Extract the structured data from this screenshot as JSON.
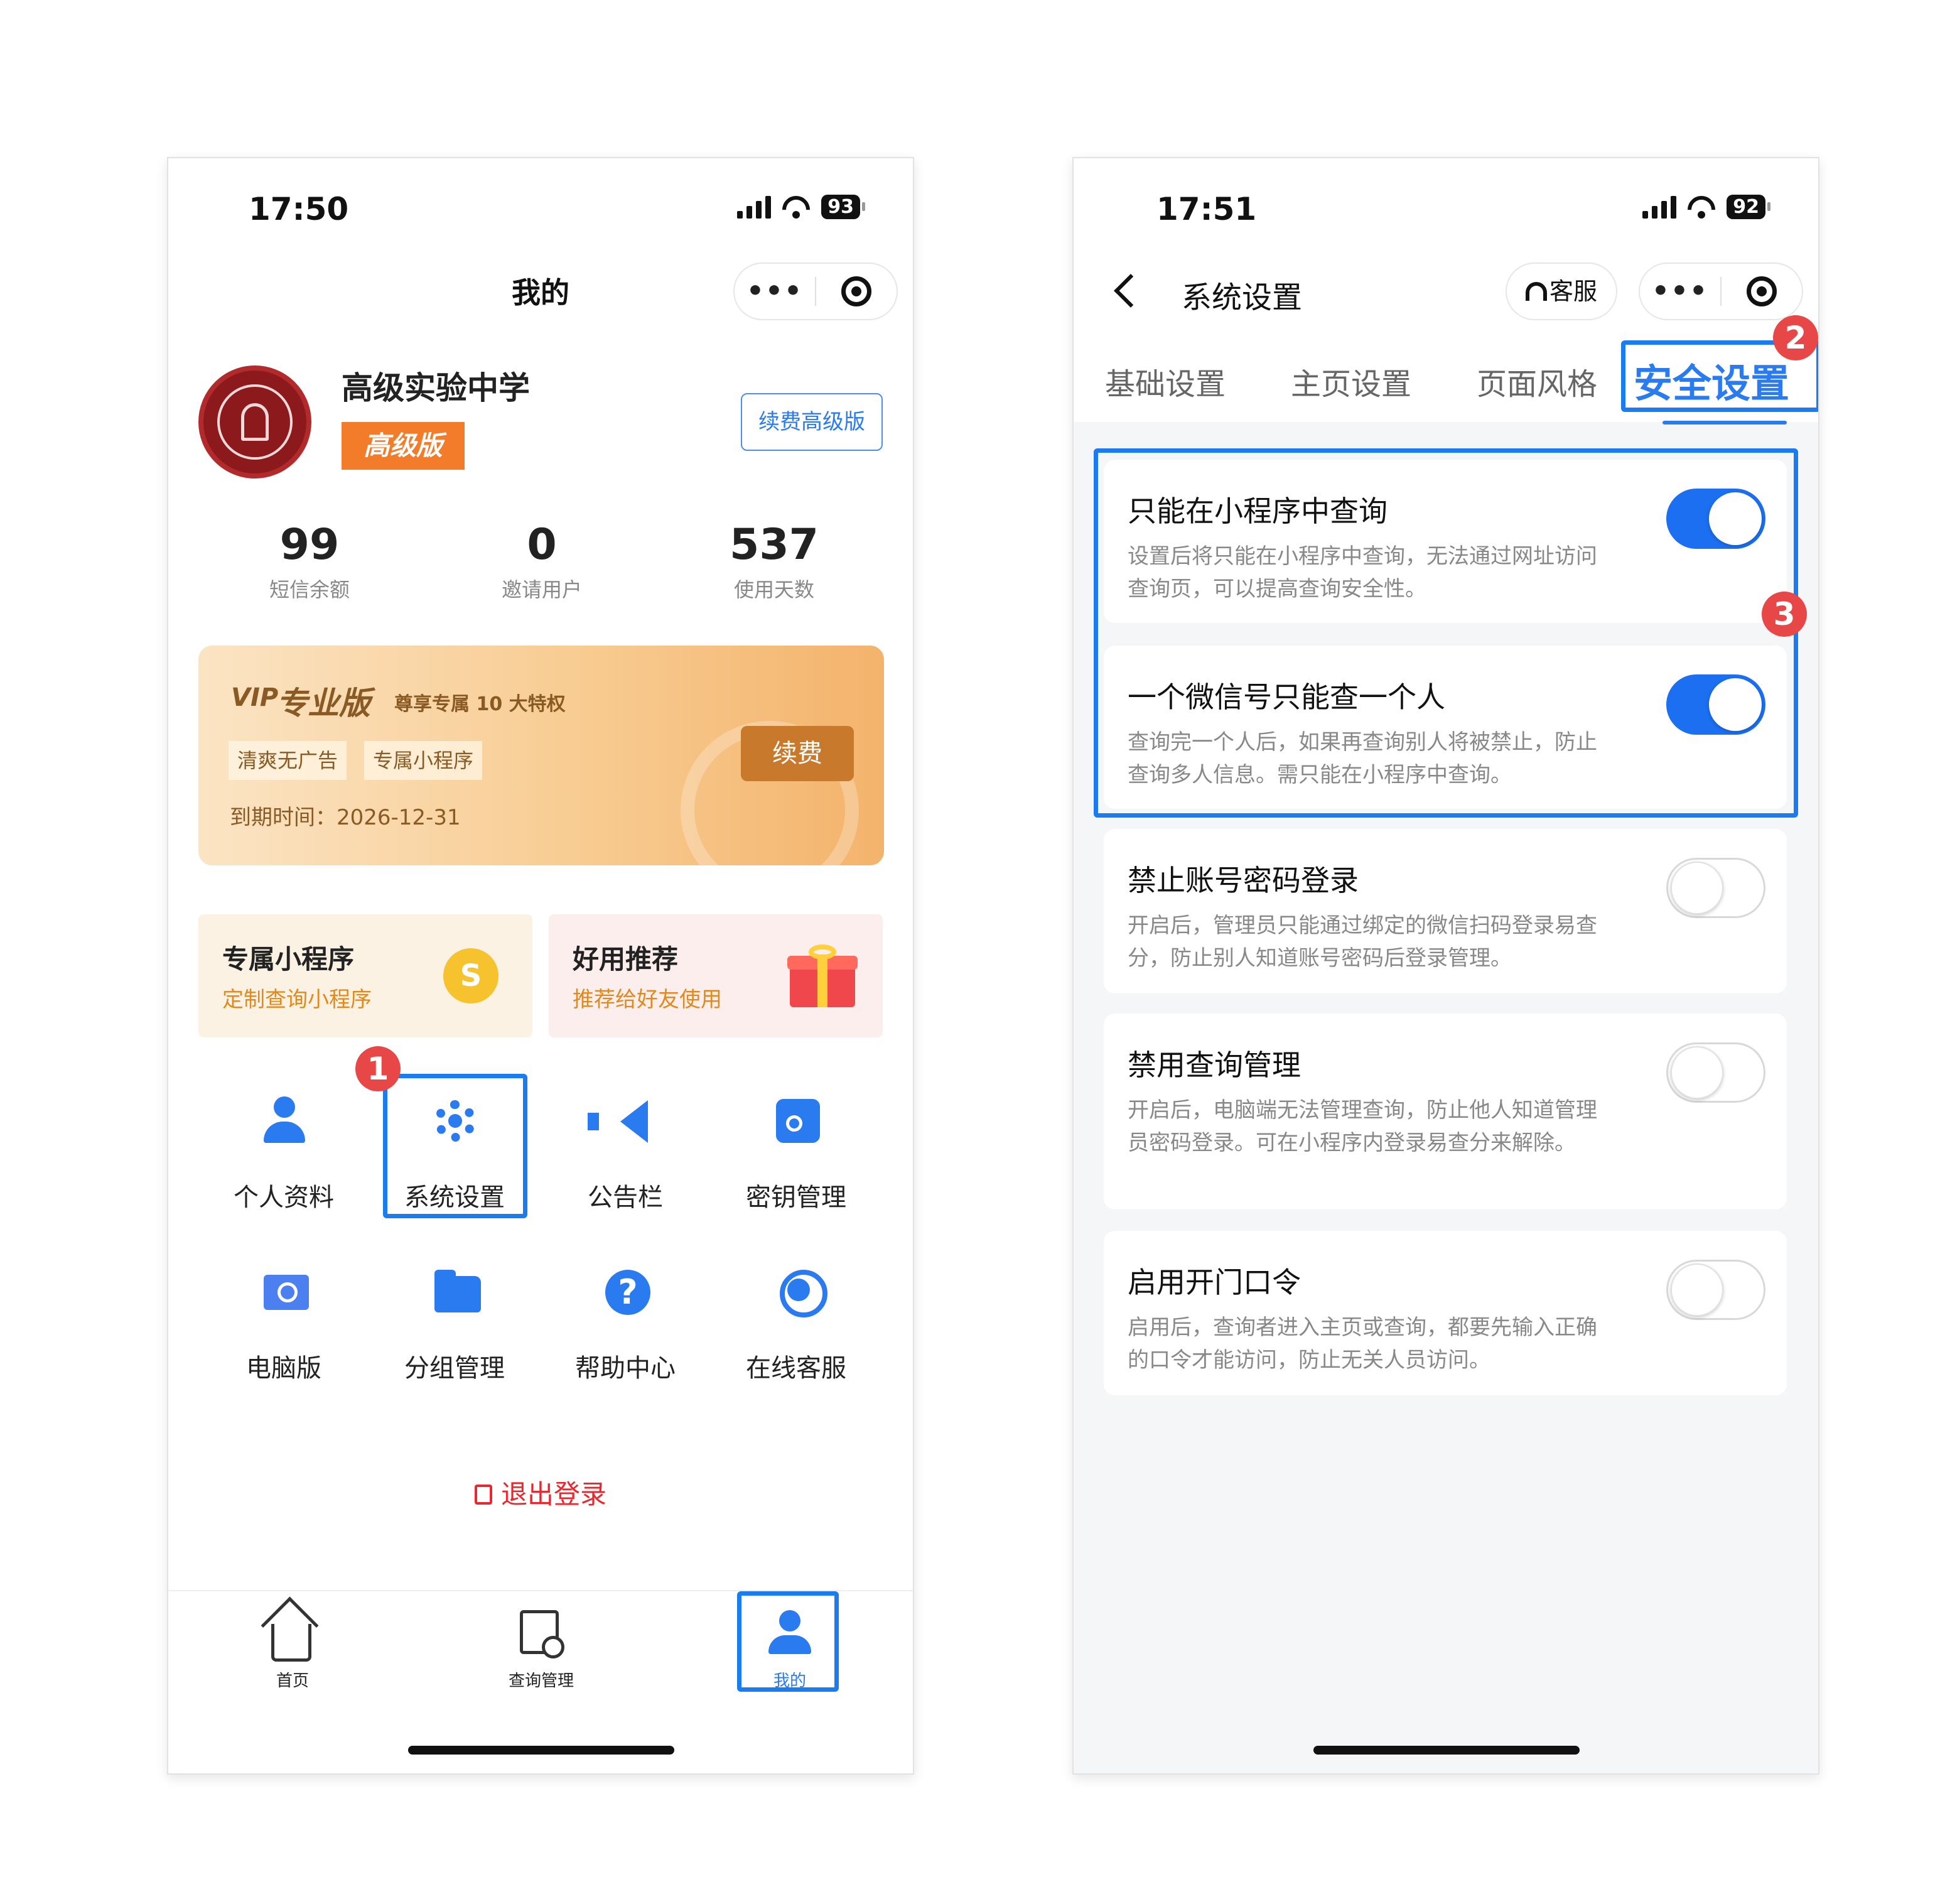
{
  "left_phone": {
    "status": {
      "time": "17:50",
      "battery": "93"
    },
    "nav_title": "我的",
    "org": {
      "name": "高级实验中学",
      "tier_badge": "高级版",
      "renew_button": "续费高级版"
    },
    "stats": [
      {
        "value": "99",
        "label": "短信余额"
      },
      {
        "value": "0",
        "label": "邀请用户"
      },
      {
        "value": "537",
        "label": "使用天数"
      }
    ],
    "vip_card": {
      "logo": "VIP",
      "title": "专业版",
      "subtitle": "尊享专属 10 大特权",
      "tags": [
        "清爽无广告",
        "专属小程序"
      ],
      "expiry": "到期时间：2026-12-31",
      "renew_button": "续费"
    },
    "promos": [
      {
        "title": "专属小程序",
        "subtitle": "定制查询小程序"
      },
      {
        "title": "好用推荐",
        "subtitle": "推荐给好友使用"
      }
    ],
    "grid": [
      {
        "label": "个人资料",
        "icon": "person-icon"
      },
      {
        "label": "系统设置",
        "icon": "gear-icon"
      },
      {
        "label": "公告栏",
        "icon": "speaker-icon"
      },
      {
        "label": "密钥管理",
        "icon": "key-icon"
      },
      {
        "label": "电脑版",
        "icon": "computer-icon"
      },
      {
        "label": "分组管理",
        "icon": "folder-icon"
      },
      {
        "label": "帮助中心",
        "icon": "help-icon"
      },
      {
        "label": "在线客服",
        "icon": "headset-icon"
      }
    ],
    "logout": "退出登录",
    "tabbar": [
      {
        "label": "首页",
        "icon": "home-icon"
      },
      {
        "label": "查询管理",
        "icon": "document-search-icon"
      },
      {
        "label": "我的",
        "icon": "user-icon"
      }
    ],
    "markers": {
      "step1": "1"
    }
  },
  "right_phone": {
    "status": {
      "time": "17:51",
      "battery": "92"
    },
    "nav_title": "系统设置",
    "service_button": "客服",
    "tabs": [
      "基础设置",
      "主页设置",
      "页面风格",
      "安全设置"
    ],
    "active_tab": "安全设置",
    "settings": [
      {
        "title": "只能在小程序中查询",
        "desc": "设置后将只能在小程序中查询，无法通过网址访问查询页，可以提高查询安全性。",
        "enabled": true
      },
      {
        "title": "一个微信号只能查一个人",
        "desc": "查询完一个人后，如果再查询别人将被禁止，防止查询多人信息。需只能在小程序中查询。",
        "enabled": true
      },
      {
        "title": "禁止账号密码登录",
        "desc": "开启后，管理员只能通过绑定的微信扫码登录易查分，防止别人知道账号密码后登录管理。",
        "enabled": false
      },
      {
        "title": "禁用查询管理",
        "desc": "开启后，电脑端无法管理查询，防止他人知道管理员密码登录。可在小程序内登录易查分来解除。",
        "enabled": false
      },
      {
        "title": "启用开门口令",
        "desc": "启用后，查询者进入主页或查询，都要先输入正确的口令才能访问，防止无关人员访问。",
        "enabled": false
      }
    ],
    "markers": {
      "step2": "2",
      "step3": "3"
    }
  },
  "colors": {
    "accent": "#2a7bf0",
    "highlight": "#1b7cf0",
    "marker": "#e74747",
    "logout": "#e8282e",
    "vip_gold": "#8a5a24"
  }
}
